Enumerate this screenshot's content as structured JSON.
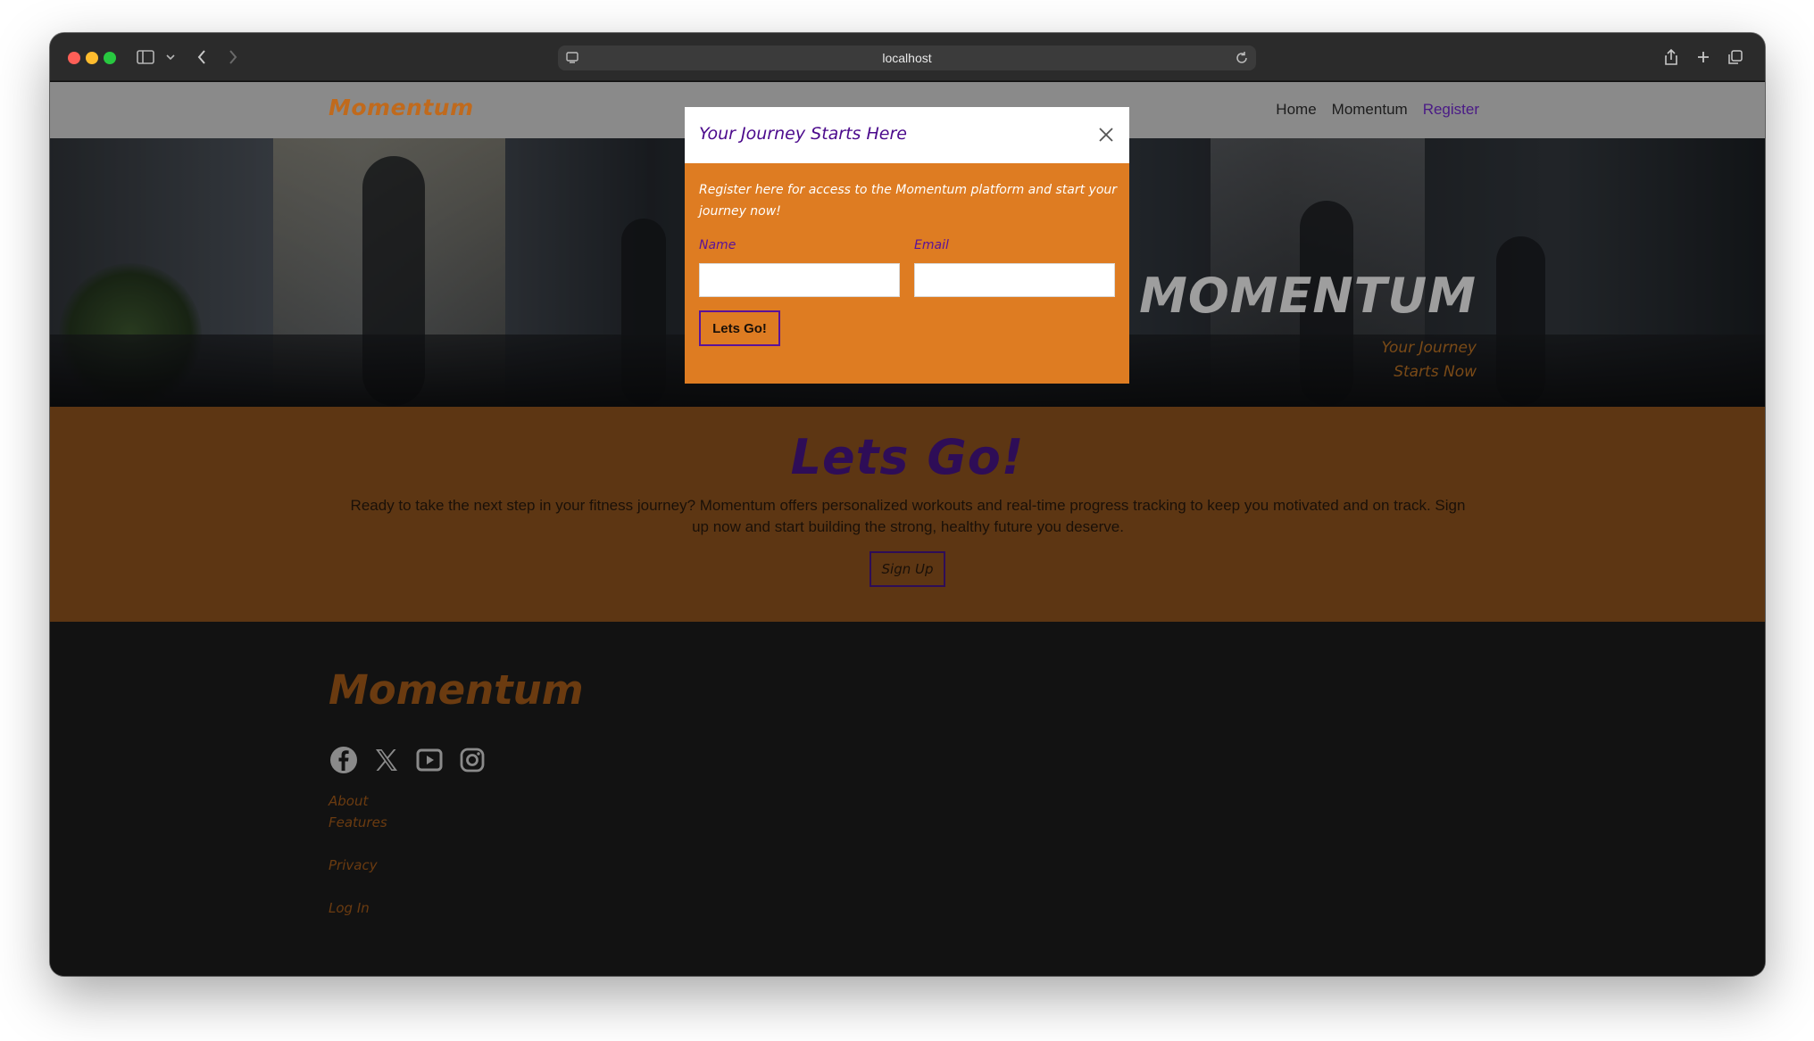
{
  "browser": {
    "url": "localhost"
  },
  "navbar": {
    "brand": "Momentum",
    "links": [
      {
        "label": "Home"
      },
      {
        "label": "Momentum"
      },
      {
        "label": "Register"
      }
    ]
  },
  "hero": {
    "title": "MOMENTUM",
    "subtitle": "Your Journey Starts Now"
  },
  "cta": {
    "title": "Lets Go!",
    "text": "Ready to take the next step in your fitness journey? Momentum offers personalized workouts and real-time progress tracking to keep you motivated and on track. Sign up now and start building the strong, healthy future you deserve.",
    "button": "Sign Up"
  },
  "footer": {
    "brand": "Momentum",
    "socials": [
      "facebook-icon",
      "x-icon",
      "youtube-icon",
      "instagram-icon"
    ],
    "links": [
      {
        "label": "About"
      },
      {
        "label": "Features"
      },
      {
        "label": "Privacy"
      },
      {
        "label": "Log In"
      }
    ]
  },
  "modal": {
    "title": "Your Journey Starts Here",
    "description": "Register here for access to the Momentum platform and start your journey now!",
    "name_label": "Name",
    "name_value": "",
    "email_label": "Email",
    "email_value": "",
    "submit": "Lets Go!"
  },
  "colors": {
    "brand_orange": "#de7c22",
    "brand_purple": "#4b0a8c"
  }
}
